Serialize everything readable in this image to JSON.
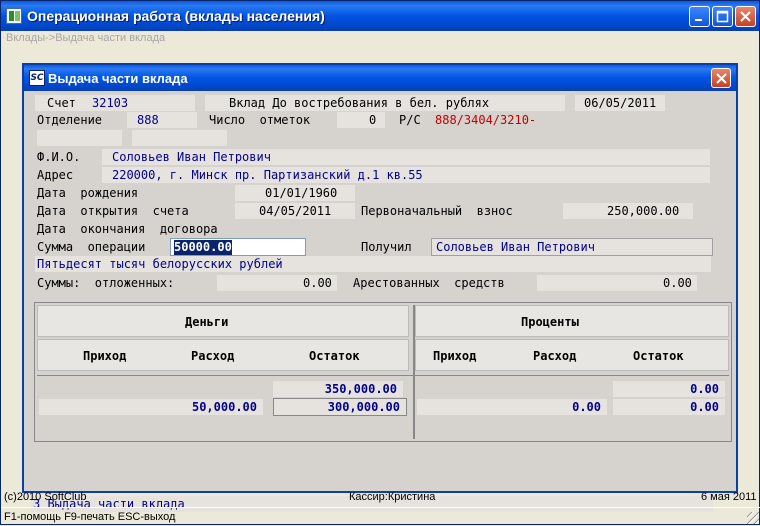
{
  "window": {
    "title": "Операционная работа (вклады населения)"
  },
  "breadcrumb": "Вклады->Выдача части вклада",
  "dialog": {
    "title": "Выдача части вклада",
    "icon": "sc-logo-icon",
    "account_label": "Счет",
    "account_number": "32103",
    "deposit_type": "Вклад До востребования в бел. рублях",
    "account_date": "06/05/2011",
    "branch_label": "Отделение",
    "branch_value": "888",
    "marks_label": "Число  отметок",
    "marks_value": "0",
    "rs_label": "Р/С",
    "rs_value": "888/3404/3210-",
    "fio_label": "Ф.И.О.",
    "fio_value": "Соловьев Иван Петрович",
    "address_label": "Адрес",
    "address_value": "220000, г. Минск пр. Партизанский д.1 кв.55",
    "birth_label": "Дата  рождения",
    "birth_value": "01/01/1960",
    "open_label": "Дата  открытия  счета",
    "open_value": "04/05/2011",
    "initial_label": "Первоначальный  взнос",
    "initial_value": "250,000.00",
    "close_label": "Дата  окончания  договора",
    "amount_label": "Сумма  операции",
    "amount_value": "50000.00",
    "recipient_label": "Получил",
    "recipient_value": "Соловьев Иван Петрович",
    "amount_words": "Пятьдесят тысяч белорусских рублей",
    "sums_label": "Суммы:  отложенных:",
    "deferred_value": "0.00",
    "arrested_label": "Арестованных  средств",
    "arrested_value": "0.00",
    "grid": {
      "money_header": "Деньги",
      "interest_header": "Проценты",
      "columns": [
        "Приход",
        "Расход",
        "Остаток",
        "Приход",
        "Расход",
        "Остаток"
      ],
      "row1": {
        "money_balance": "350,000.00",
        "interest_balance": "0.00"
      },
      "row2": {
        "money_expense": "50,000.00",
        "money_balance": "300,000.00",
        "interest_expense": "0.00",
        "interest_balance": "0.00"
      }
    },
    "status_line": "3 Выдача части вклада"
  },
  "footer": {
    "copyright": "(c)2010 SoftClub",
    "cashier": "Кассир:Кристина",
    "date": "6 мая 2011",
    "hotkeys": "F1-помощь  F9-печать  ESC-выход"
  }
}
